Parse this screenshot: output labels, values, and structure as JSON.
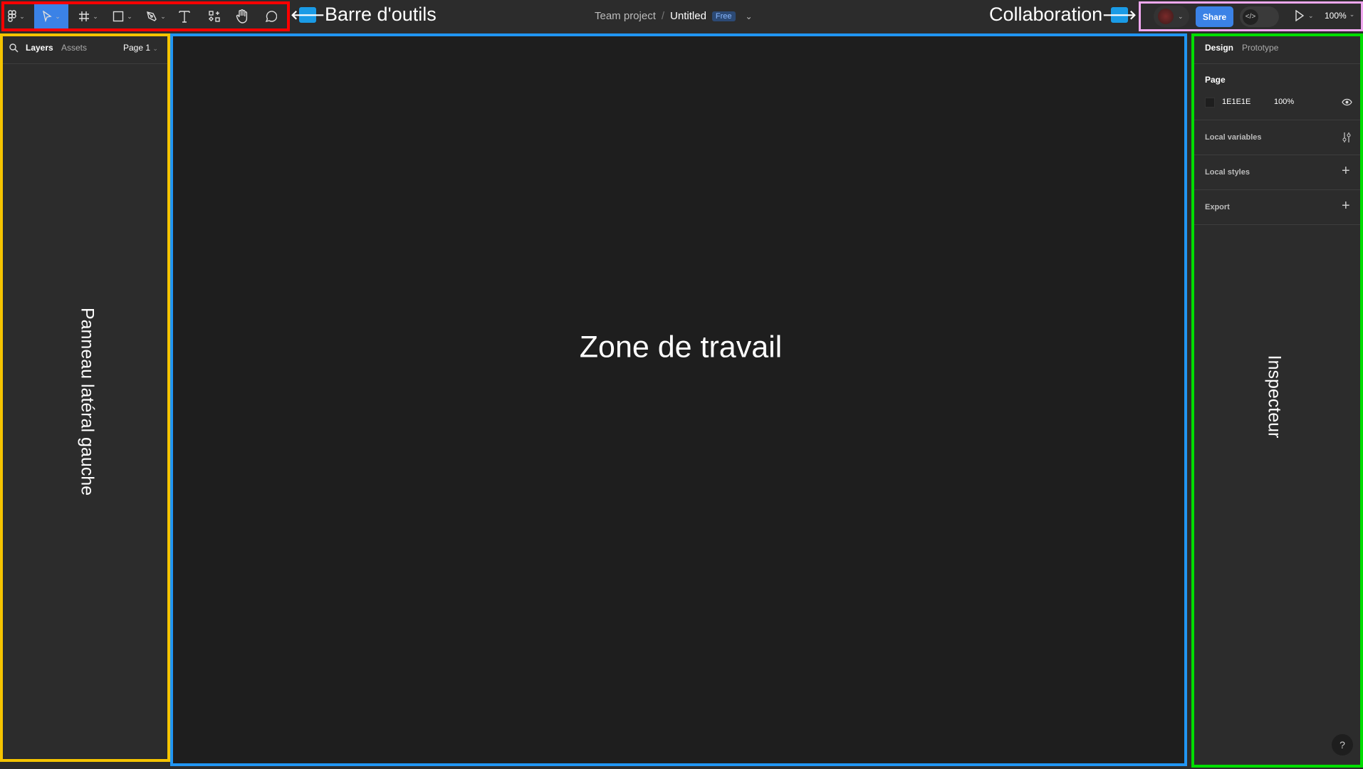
{
  "toolbar": {
    "tools": [
      "main-menu",
      "move",
      "frame",
      "shape",
      "pen",
      "text",
      "resources",
      "hand",
      "comment"
    ]
  },
  "file": {
    "project": "Team project",
    "separator": "/",
    "name": "Untitled",
    "plan_badge": "Free"
  },
  "collab": {
    "share_label": "Share",
    "zoom_level": "100%"
  },
  "left_panel": {
    "tabs": [
      "Layers",
      "Assets"
    ],
    "page_selector": "Page 1"
  },
  "inspector": {
    "tabs": [
      "Design",
      "Prototype"
    ],
    "page_heading": "Page",
    "bg_color_hex": "1E1E1E",
    "bg_opacity": "100%",
    "sections": [
      "Local variables",
      "Local styles",
      "Export"
    ],
    "help": "?"
  },
  "annotations": {
    "toolbar": "Barre d'outils",
    "collaboration": "Collaboration",
    "left_panel": "Panneau latéral gauche",
    "canvas": "Zone de travail",
    "inspector": "Inspecteur"
  },
  "colors": {
    "toolbar_box": "#ff0000",
    "left_box": "#f5c400",
    "canvas_box": "#2196f3",
    "inspector_box": "#00dd00",
    "collab_box": "#f0a8f0",
    "accent": "#3b82e6",
    "page_bg": "#1E1E1E"
  }
}
